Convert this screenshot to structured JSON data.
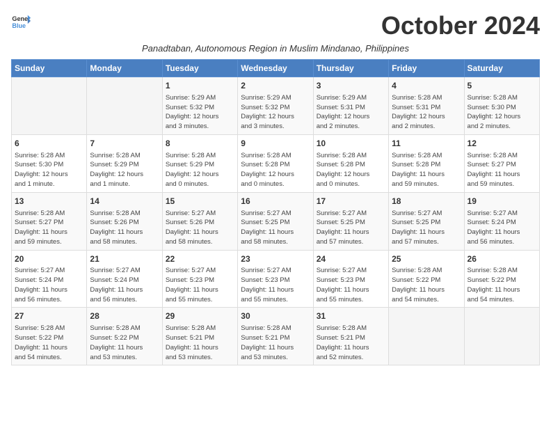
{
  "header": {
    "logo_line1": "General",
    "logo_line2": "Blue",
    "month": "October 2024",
    "subtitle": "Panadtaban, Autonomous Region in Muslim Mindanao, Philippines"
  },
  "weekdays": [
    "Sunday",
    "Monday",
    "Tuesday",
    "Wednesday",
    "Thursday",
    "Friday",
    "Saturday"
  ],
  "weeks": [
    [
      {
        "day": "",
        "info": ""
      },
      {
        "day": "",
        "info": ""
      },
      {
        "day": "1",
        "info": "Sunrise: 5:29 AM\nSunset: 5:32 PM\nDaylight: 12 hours\nand 3 minutes."
      },
      {
        "day": "2",
        "info": "Sunrise: 5:29 AM\nSunset: 5:32 PM\nDaylight: 12 hours\nand 3 minutes."
      },
      {
        "day": "3",
        "info": "Sunrise: 5:29 AM\nSunset: 5:31 PM\nDaylight: 12 hours\nand 2 minutes."
      },
      {
        "day": "4",
        "info": "Sunrise: 5:28 AM\nSunset: 5:31 PM\nDaylight: 12 hours\nand 2 minutes."
      },
      {
        "day": "5",
        "info": "Sunrise: 5:28 AM\nSunset: 5:30 PM\nDaylight: 12 hours\nand 2 minutes."
      }
    ],
    [
      {
        "day": "6",
        "info": "Sunrise: 5:28 AM\nSunset: 5:30 PM\nDaylight: 12 hours\nand 1 minute."
      },
      {
        "day": "7",
        "info": "Sunrise: 5:28 AM\nSunset: 5:29 PM\nDaylight: 12 hours\nand 1 minute."
      },
      {
        "day": "8",
        "info": "Sunrise: 5:28 AM\nSunset: 5:29 PM\nDaylight: 12 hours\nand 0 minutes."
      },
      {
        "day": "9",
        "info": "Sunrise: 5:28 AM\nSunset: 5:28 PM\nDaylight: 12 hours\nand 0 minutes."
      },
      {
        "day": "10",
        "info": "Sunrise: 5:28 AM\nSunset: 5:28 PM\nDaylight: 12 hours\nand 0 minutes."
      },
      {
        "day": "11",
        "info": "Sunrise: 5:28 AM\nSunset: 5:28 PM\nDaylight: 11 hours\nand 59 minutes."
      },
      {
        "day": "12",
        "info": "Sunrise: 5:28 AM\nSunset: 5:27 PM\nDaylight: 11 hours\nand 59 minutes."
      }
    ],
    [
      {
        "day": "13",
        "info": "Sunrise: 5:28 AM\nSunset: 5:27 PM\nDaylight: 11 hours\nand 59 minutes."
      },
      {
        "day": "14",
        "info": "Sunrise: 5:28 AM\nSunset: 5:26 PM\nDaylight: 11 hours\nand 58 minutes."
      },
      {
        "day": "15",
        "info": "Sunrise: 5:27 AM\nSunset: 5:26 PM\nDaylight: 11 hours\nand 58 minutes."
      },
      {
        "day": "16",
        "info": "Sunrise: 5:27 AM\nSunset: 5:25 PM\nDaylight: 11 hours\nand 58 minutes."
      },
      {
        "day": "17",
        "info": "Sunrise: 5:27 AM\nSunset: 5:25 PM\nDaylight: 11 hours\nand 57 minutes."
      },
      {
        "day": "18",
        "info": "Sunrise: 5:27 AM\nSunset: 5:25 PM\nDaylight: 11 hours\nand 57 minutes."
      },
      {
        "day": "19",
        "info": "Sunrise: 5:27 AM\nSunset: 5:24 PM\nDaylight: 11 hours\nand 56 minutes."
      }
    ],
    [
      {
        "day": "20",
        "info": "Sunrise: 5:27 AM\nSunset: 5:24 PM\nDaylight: 11 hours\nand 56 minutes."
      },
      {
        "day": "21",
        "info": "Sunrise: 5:27 AM\nSunset: 5:24 PM\nDaylight: 11 hours\nand 56 minutes."
      },
      {
        "day": "22",
        "info": "Sunrise: 5:27 AM\nSunset: 5:23 PM\nDaylight: 11 hours\nand 55 minutes."
      },
      {
        "day": "23",
        "info": "Sunrise: 5:27 AM\nSunset: 5:23 PM\nDaylight: 11 hours\nand 55 minutes."
      },
      {
        "day": "24",
        "info": "Sunrise: 5:27 AM\nSunset: 5:23 PM\nDaylight: 11 hours\nand 55 minutes."
      },
      {
        "day": "25",
        "info": "Sunrise: 5:28 AM\nSunset: 5:22 PM\nDaylight: 11 hours\nand 54 minutes."
      },
      {
        "day": "26",
        "info": "Sunrise: 5:28 AM\nSunset: 5:22 PM\nDaylight: 11 hours\nand 54 minutes."
      }
    ],
    [
      {
        "day": "27",
        "info": "Sunrise: 5:28 AM\nSunset: 5:22 PM\nDaylight: 11 hours\nand 54 minutes."
      },
      {
        "day": "28",
        "info": "Sunrise: 5:28 AM\nSunset: 5:22 PM\nDaylight: 11 hours\nand 53 minutes."
      },
      {
        "day": "29",
        "info": "Sunrise: 5:28 AM\nSunset: 5:21 PM\nDaylight: 11 hours\nand 53 minutes."
      },
      {
        "day": "30",
        "info": "Sunrise: 5:28 AM\nSunset: 5:21 PM\nDaylight: 11 hours\nand 53 minutes."
      },
      {
        "day": "31",
        "info": "Sunrise: 5:28 AM\nSunset: 5:21 PM\nDaylight: 11 hours\nand 52 minutes."
      },
      {
        "day": "",
        "info": ""
      },
      {
        "day": "",
        "info": ""
      }
    ]
  ]
}
